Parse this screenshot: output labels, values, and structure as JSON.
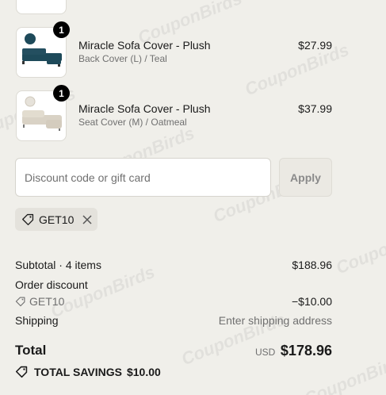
{
  "watermark": "CouponBirds",
  "items": [
    {
      "qty": "1",
      "title": "Miracle Sofa Cover - Plush",
      "variant": "Back Cover (L) / Teal",
      "price": "$27.99",
      "swatch": "#1e4a5a"
    },
    {
      "qty": "1",
      "title": "Miracle Sofa Cover - Plush",
      "variant": "Seat Cover (M) / Oatmeal",
      "price": "$37.99",
      "swatch": "#d9d2c5"
    }
  ],
  "discount": {
    "placeholder": "Discount code or gift card",
    "apply_label": "Apply",
    "applied_code": "GET10"
  },
  "summary": {
    "subtotal_label": "Subtotal · 4 items",
    "subtotal_value": "$188.96",
    "order_discount_label": "Order discount",
    "discount_code": "GET10",
    "discount_value": "−$10.00",
    "shipping_label": "Shipping",
    "shipping_value": "Enter shipping address",
    "total_label": "Total",
    "currency": "USD",
    "total_value": "$178.96",
    "savings_label": "TOTAL SAVINGS",
    "savings_value": "$10.00"
  }
}
